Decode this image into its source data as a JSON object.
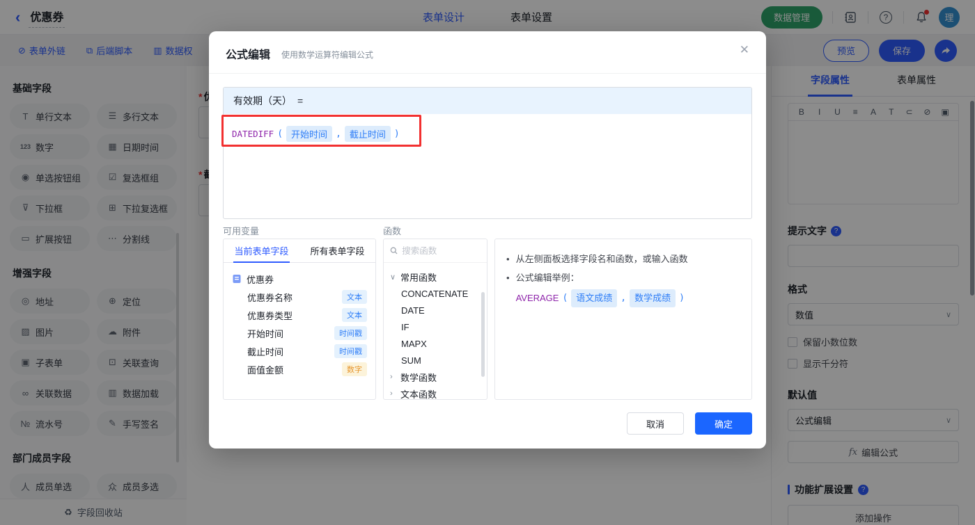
{
  "topbar": {
    "back_icon": "‹",
    "title": "优惠券",
    "tabs": [
      {
        "label": "表单设计"
      },
      {
        "label": "表单设置"
      }
    ],
    "data_manage_label": "数据管理",
    "help_glyph": "?",
    "avatar_text": "理"
  },
  "toolbar": {
    "links": [
      {
        "icon": "⊘",
        "label": "表单外链"
      },
      {
        "icon": "⧉",
        "label": "后端脚本"
      },
      {
        "icon": "▥",
        "label": "数据权"
      }
    ],
    "preview_label": "预览",
    "save_label": "保存"
  },
  "sidebar": {
    "sections": [
      {
        "title": "基础字段",
        "items": [
          {
            "icon": "T",
            "label": "单行文本"
          },
          {
            "icon": "☰",
            "label": "多行文本"
          },
          {
            "icon": "123",
            "label": "数字",
            "num": true
          },
          {
            "icon": "▦",
            "label": "日期时间"
          },
          {
            "icon": "◉",
            "label": "单选按钮组"
          },
          {
            "icon": "☑",
            "label": "复选框组"
          },
          {
            "icon": "⊽",
            "label": "下拉框"
          },
          {
            "icon": "⊞",
            "label": "下拉复选框"
          },
          {
            "icon": "▭",
            "label": "扩展按钮"
          },
          {
            "icon": "⋯",
            "label": "分割线"
          }
        ]
      },
      {
        "title": "增强字段",
        "items": [
          {
            "icon": "◎",
            "label": "地址"
          },
          {
            "icon": "⊕",
            "label": "定位"
          },
          {
            "icon": "▨",
            "label": "图片"
          },
          {
            "icon": "☁",
            "label": "附件"
          },
          {
            "icon": "▣",
            "label": "子表单"
          },
          {
            "icon": "⊡",
            "label": "关联查询"
          },
          {
            "icon": "∞",
            "label": "关联数据"
          },
          {
            "icon": "▥",
            "label": "数据加载"
          },
          {
            "icon": "№",
            "label": "流水号"
          },
          {
            "icon": "✎",
            "label": "手写签名"
          }
        ]
      },
      {
        "title": "部门成员字段",
        "items": [
          {
            "icon": "人",
            "label": "成员单选"
          },
          {
            "icon": "众",
            "label": "成员多选"
          },
          {
            "icon": "",
            "label": ""
          },
          {
            "icon": "",
            "label": ""
          }
        ]
      }
    ],
    "recycle_icon": "♻",
    "recycle_label": "字段回收站"
  },
  "canvas": {
    "fields": [
      {
        "required": "*",
        "label": "优"
      },
      {
        "required": "*",
        "label": "截"
      }
    ]
  },
  "modal": {
    "title": "公式编辑",
    "subtitle": "使用数学运算符编辑公式",
    "close_icon": "✕",
    "target": "有效期（天）",
    "equals": "=",
    "formula_tokens": [
      {
        "kind": "func",
        "text": "DATEDIFF"
      },
      {
        "kind": "punct",
        "text": "("
      },
      {
        "kind": "field",
        "text": "开始时间"
      },
      {
        "kind": "punct",
        "text": ","
      },
      {
        "kind": "field",
        "text": "截止时间"
      },
      {
        "kind": "punct",
        "text": ")"
      }
    ],
    "vars_label": "可用变量",
    "vars_tabs": [
      {
        "label": "当前表单字段"
      },
      {
        "label": "所有表单字段"
      }
    ],
    "form_name": "优惠券",
    "variables": [
      {
        "name": "优惠券名称",
        "type": "文本",
        "kind": "text"
      },
      {
        "name": "优惠券类型",
        "type": "文本",
        "kind": "text"
      },
      {
        "name": "开始时间",
        "type": "时间戳",
        "kind": "time"
      },
      {
        "name": "截止时间",
        "type": "时间戳",
        "kind": "time"
      },
      {
        "name": "面值金额",
        "type": "数字",
        "kind": "number"
      }
    ],
    "funcs_label": "函数",
    "search_placeholder": "搜索函数",
    "func_group_open": {
      "chevron": "∨",
      "label": "常用函数"
    },
    "func_items": [
      {
        "name": "CONCATENATE"
      },
      {
        "name": "DATE"
      },
      {
        "name": "IF"
      },
      {
        "name": "MAPX"
      },
      {
        "name": "SUM"
      }
    ],
    "func_groups_closed": [
      {
        "chevron": "›",
        "label": "数学函数"
      },
      {
        "chevron": "›",
        "label": "文本函数"
      }
    ],
    "tip1": "从左侧面板选择字段名和函数，或输入函数",
    "tip2_prefix": "公式编辑举例：",
    "example_tokens": [
      {
        "kind": "func",
        "text": "AVERAGE"
      },
      {
        "kind": "punct",
        "text": "("
      },
      {
        "kind": "field",
        "text": "语文成绩"
      },
      {
        "kind": "punct",
        "text": ","
      },
      {
        "kind": "field",
        "text": "数学成绩"
      },
      {
        "kind": "punct",
        "text": ")"
      }
    ],
    "cancel_label": "取消",
    "ok_label": "确定"
  },
  "panel": {
    "tabs": [
      {
        "label": "字段属性"
      },
      {
        "label": "表单属性"
      }
    ],
    "editor_tools": [
      {
        "glyph": "B"
      },
      {
        "glyph": "I"
      },
      {
        "glyph": "U"
      },
      {
        "glyph": "≡"
      },
      {
        "glyph": "A"
      },
      {
        "glyph": "T"
      },
      {
        "glyph": "⊂"
      },
      {
        "glyph": "⊘"
      },
      {
        "glyph": "▣"
      }
    ],
    "hint_label": "提示文字",
    "help_glyph": "?",
    "format_label": "格式",
    "format_value": "数值",
    "checkbox1": "保留小数位数",
    "checkbox2": "显示千分符",
    "default_label": "默认值",
    "default_value": "公式编辑",
    "fx": "fx",
    "edit_formula_label": "编辑公式",
    "ext_label": "功能扩展设置",
    "add_action_label": "添加操作"
  },
  "colors": {
    "primary_blue": "#2E5BFF",
    "ok_blue": "#1B66FF",
    "green": "#2FA56B",
    "annotation_red": "#F23030",
    "function_purple": "#8E24AA",
    "chip_blue": "#2F7EF7",
    "badge_orange": "#E6962E"
  }
}
